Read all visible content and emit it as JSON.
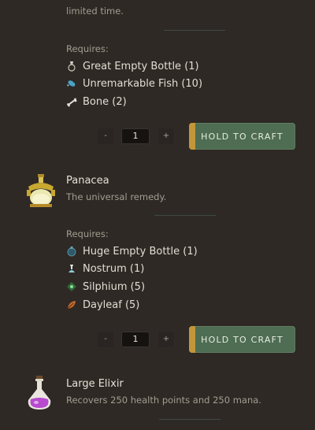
{
  "top": {
    "desc_tail": "limited time."
  },
  "recipe1": {
    "requires_label": "Requires:",
    "ingredients": [
      {
        "label": "Great Empty Bottle (1)",
        "icon": "great-empty-bottle-icon"
      },
      {
        "label": "Unremarkable Fish (10)",
        "icon": "fish-icon"
      },
      {
        "label": "Bone (2)",
        "icon": "bone-icon"
      }
    ],
    "minus": "-",
    "qty": "1",
    "plus": "+",
    "craft_label": "HOLD TO CRAFT"
  },
  "recipe2": {
    "title": "Panacea",
    "desc": "The universal remedy.",
    "requires_label": "Requires:",
    "ingredients": [
      {
        "label": "Huge Empty Bottle (1)",
        "icon": "huge-empty-bottle-icon"
      },
      {
        "label": "Nostrum (1)",
        "icon": "nostrum-icon"
      },
      {
        "label": "Silphium (5)",
        "icon": "silphium-icon"
      },
      {
        "label": "Dayleaf (5)",
        "icon": "dayleaf-icon"
      }
    ],
    "minus": "-",
    "qty": "1",
    "plus": "+",
    "craft_label": "HOLD TO CRAFT"
  },
  "recipe3": {
    "title": "Large Elixir",
    "desc": "Recovers 250 health points and 250 mana."
  },
  "colors": {
    "craft_green": "#4e6d52",
    "craft_accent": "#c29639",
    "bg": "#2e2925"
  }
}
